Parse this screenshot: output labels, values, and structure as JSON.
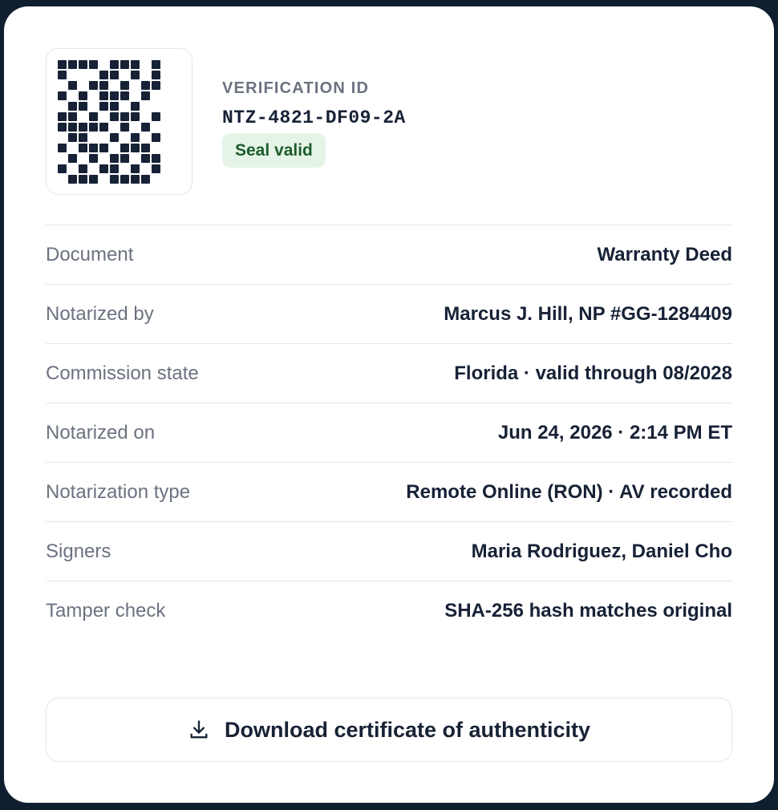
{
  "header": {
    "qr_icon": "qr-code",
    "verification_label": "VERIFICATION ID",
    "verification_id": "NTZ-4821-DF09-2A",
    "status_badge": "Seal valid",
    "status_color": "#1e5c2c",
    "status_bg": "#e5f4e7"
  },
  "details": [
    {
      "label": "Document",
      "value": "Warranty Deed"
    },
    {
      "label": "Notarized by",
      "value": "Marcus J. Hill, NP #GG-1284409"
    },
    {
      "label": "Commission state",
      "value": "Florida · valid through 08/2028"
    },
    {
      "label": "Notarized on",
      "value": "Jun 24, 2026 · 2:14 PM ET"
    },
    {
      "label": "Notarization type",
      "value": "Remote Online (RON) · AV recorded"
    },
    {
      "label": "Signers",
      "value": "Maria Rodriguez, Daniel Cho"
    },
    {
      "label": "Tamper check",
      "value": "SHA-256 hash matches original"
    }
  ],
  "download": {
    "icon": "download-icon",
    "label": "Download certificate of authenticity"
  },
  "colors": {
    "background": "#0f1f30",
    "text": "#172236",
    "muted": "#6b7280"
  }
}
